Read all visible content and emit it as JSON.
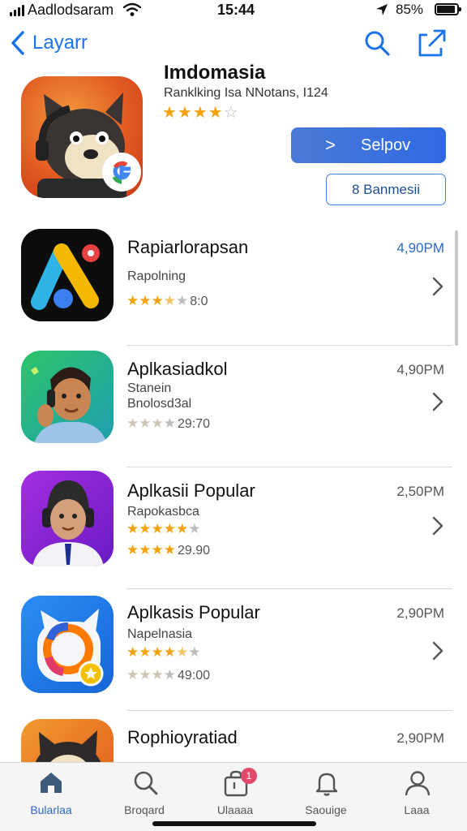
{
  "status_bar": {
    "carrier": "Aadlodsaram",
    "time": "15:44",
    "battery": "85%",
    "icons": [
      "signal-icon",
      "wifi-icon",
      "location-icon",
      "battery-icon"
    ]
  },
  "nav": {
    "back_label": "Layarr",
    "icons": [
      "chevron-left-icon",
      "search-icon",
      "share-icon"
    ]
  },
  "header": {
    "title": "Imdomasia",
    "subtitle": "Ranklking Isa NNotans, I124",
    "rating": 4.5,
    "primary_button": "Selpov",
    "primary_button_icon": ">",
    "secondary_button": "8 Banmesii"
  },
  "list": [
    {
      "title": "Rapiarlorapsan",
      "time": "4,90PM",
      "time_highlight": true,
      "line1": "Rapolning",
      "line2": "",
      "rating": 3.5,
      "rating_text": "8:0"
    },
    {
      "title": "Aplkasiadkol",
      "time": "4,90PM",
      "time_highlight": false,
      "line1": "Stanein",
      "line2": "Bnolosd3al",
      "rating": 3,
      "rating_text": "29:70"
    },
    {
      "title": "Aplkasii Popular",
      "time": "2,50PM",
      "time_highlight": false,
      "line1": "Rapokasbca",
      "line2": "",
      "rating": 4,
      "rating_text": "29.90"
    },
    {
      "title": "Aplkasis Popular",
      "time": "2,90PM",
      "time_highlight": false,
      "line1": "Napelnasia",
      "line2": "",
      "rating": 3,
      "rating_text": "49:00"
    },
    {
      "title": "Rophioyratiad",
      "time": "2,90PM",
      "time_highlight": false,
      "line1": "",
      "line2": "",
      "rating": 0,
      "rating_text": ""
    }
  ],
  "tab_bar": {
    "tabs": [
      {
        "label": "Bularlaa",
        "icon": "home-icon",
        "active": true
      },
      {
        "label": "Broqard",
        "icon": "search-icon",
        "active": false
      },
      {
        "label": "Ulaaaa",
        "icon": "bag-icon",
        "active": false,
        "badge": "1"
      },
      {
        "label": "Saouige",
        "icon": "bell-icon",
        "active": false
      },
      {
        "label": "Laaa",
        "icon": "profile-icon",
        "active": false
      }
    ]
  },
  "colors": {
    "accent": "#2a68c9",
    "star": "#f2a30f",
    "badge": "#e24a6b"
  }
}
